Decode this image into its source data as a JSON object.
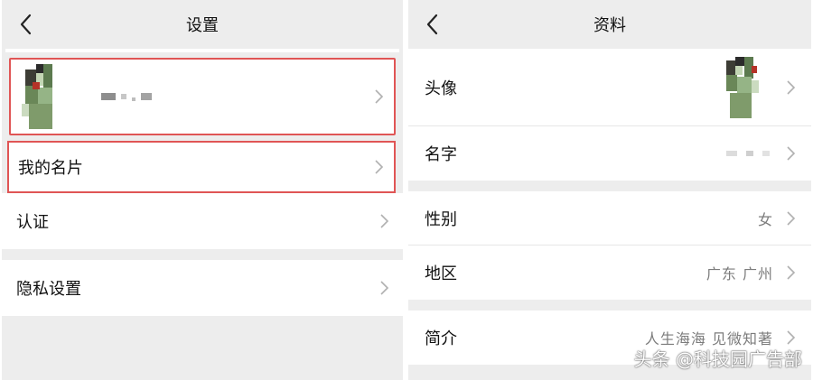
{
  "left": {
    "title": "设置",
    "items": {
      "my_card": "我的名片",
      "verify": "认证",
      "privacy": "隐私设置"
    }
  },
  "right": {
    "title": "资料",
    "rows": {
      "avatar": "头像",
      "name": "名字",
      "gender": "性别",
      "gender_value": "女",
      "region": "地区",
      "region_value": "广东 广州",
      "intro": "简介",
      "intro_value": "人生海海 见微知著"
    }
  },
  "watermark": "头条 @科技园广告部",
  "colors": {
    "background": "#ededed",
    "highlight_border": "#e05555",
    "secondary_text": "#7c7c7c"
  },
  "icons": [
    "back-arrow-icon",
    "chevron-right-icon"
  ]
}
